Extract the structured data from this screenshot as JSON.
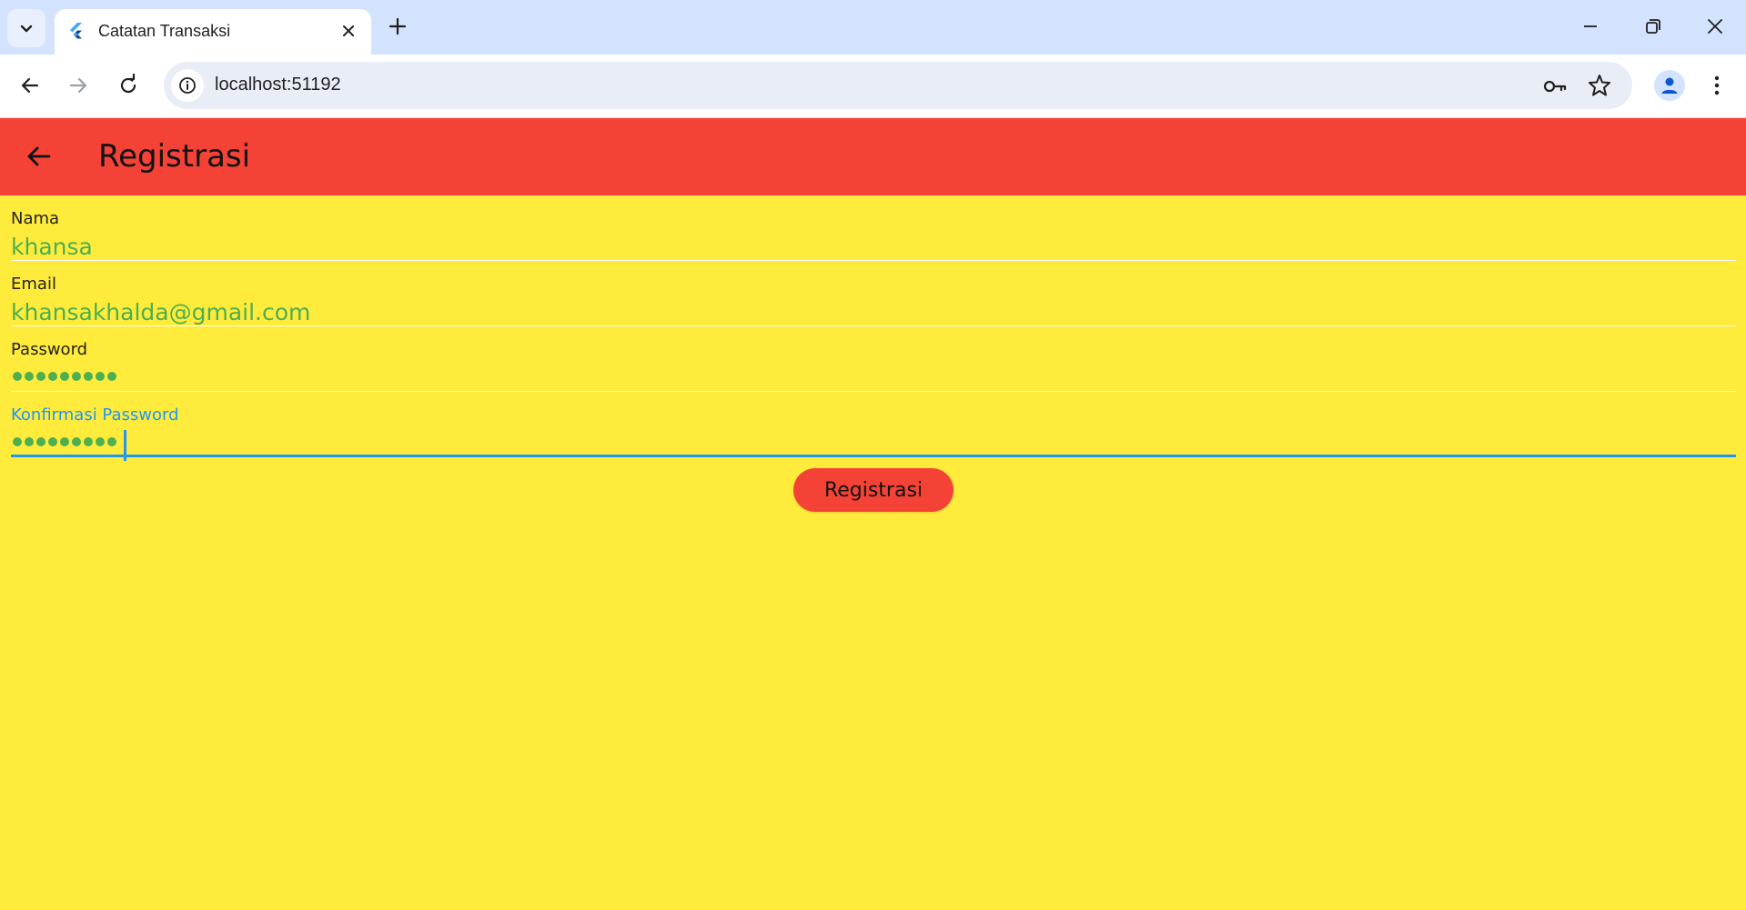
{
  "browser": {
    "tab_title": "Catatan Transaksi",
    "url": "localhost:51192",
    "icons": {
      "tab_search": "chevron-down-icon",
      "favicon": "flutter-icon",
      "tab_close": "close-icon",
      "new_tab": "plus-icon",
      "back": "arrow-left-icon",
      "forward": "arrow-right-icon",
      "reload": "reload-icon",
      "site_info": "info-icon",
      "password": "key-icon",
      "bookmark": "star-icon",
      "profile": "person-icon",
      "menu": "kebab-menu-icon"
    }
  },
  "appbar": {
    "title": "Registrasi",
    "back_icon": "arrow-left-icon",
    "color": "#f44336"
  },
  "form": {
    "background": "#ffeb3b",
    "fields": [
      {
        "label": "Nama",
        "value": "khansa",
        "type": "text"
      },
      {
        "label": "Email",
        "value": "khansakhalda@gmail.com",
        "type": "text"
      },
      {
        "label": "Password",
        "value_masked_length": 9,
        "type": "password"
      },
      {
        "label": "Konfirmasi Password",
        "value_masked_length": 9,
        "type": "password",
        "focused": true
      }
    ],
    "value_color": "#4caf50",
    "focus_color": "#2196f3",
    "submit_label": "Registrasi"
  }
}
